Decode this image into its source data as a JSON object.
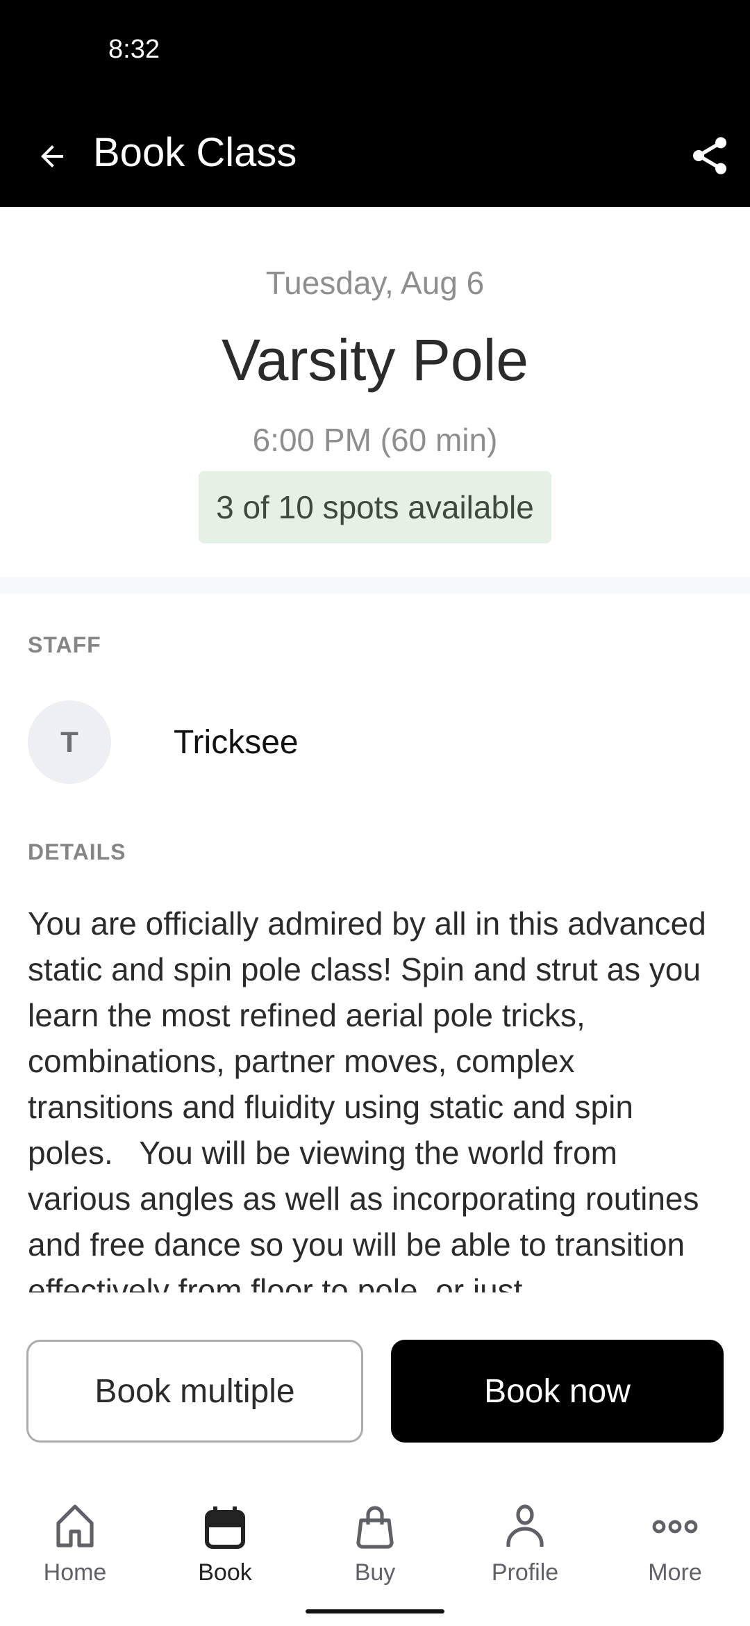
{
  "status_bar": {
    "time": "8:32"
  },
  "app_bar": {
    "title": "Book Class",
    "back_icon": "arrow-left-icon",
    "share_icon": "share-icon"
  },
  "class": {
    "date": "Tuesday, Aug 6",
    "name": "Varsity Pole",
    "time": "6:00 PM (60 min)",
    "spots": "3 of 10 spots available",
    "spots_available": 3,
    "spots_total": 10
  },
  "staff": {
    "label": "STAFF",
    "initial": "T",
    "name": "Tricksee"
  },
  "details": {
    "label": "DETAILS",
    "text": "You are officially admired by all in this advanced static and spin pole class! Spin and strut as you learn the most refined aerial pole tricks, combinations, partner moves, complex transitions and fluidity using static and spin poles.   You will be viewing the world from various angles as well as incorporating routines and free dance so you will be able to transition effectively from floor to pole, or just"
  },
  "actions": {
    "book_multiple": "Book multiple",
    "book_now": "Book now"
  },
  "nav": {
    "items": [
      {
        "label": "Home",
        "icon": "home-icon"
      },
      {
        "label": "Book",
        "icon": "calendar-icon",
        "active": true
      },
      {
        "label": "Buy",
        "icon": "shopping-bag-icon"
      },
      {
        "label": "Profile",
        "icon": "person-icon"
      },
      {
        "label": "More",
        "icon": "more-horizontal-icon"
      }
    ]
  },
  "colors": {
    "header_bg": "#000000",
    "spots_badge_bg": "#e4f1e4",
    "primary_button": "#000000"
  }
}
